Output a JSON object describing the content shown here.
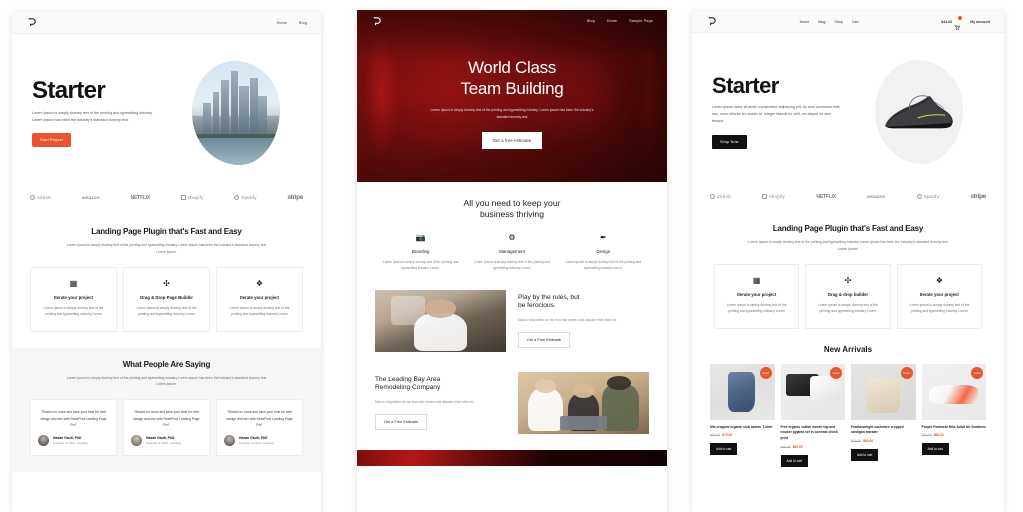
{
  "panels": [
    {
      "id": "starter-agency",
      "nav": {
        "links": [
          "Home",
          "Blog"
        ]
      },
      "hero": {
        "title": "Starter",
        "paragraph": "Lorem Ipsum is simply dummy text of the printing and typesetting industry. Lorem Ipsum has been the industry's standard dummy text.",
        "cta": "Start Project"
      },
      "logos": [
        "airbnb",
        "amazon",
        "NETFLIX",
        "shopify",
        "Spotify",
        "stripe"
      ],
      "features": {
        "title": "Landing Page Plugin that's Fast and Easy",
        "subtitle": "Lorem Ipsum is simply dummy text of the printing and typesetting industry Lorem Ipsum has been the industry's standard dummy text Lorem Ipsum.",
        "cards": [
          {
            "icon": "chart-icon",
            "glyph": "▦",
            "title": "Iterate your project",
            "text": "Lorem Ipsum is simply dummy text of the printing and typesetting industry Lorem"
          },
          {
            "icon": "drag-drop-icon",
            "glyph": "✣",
            "title": "Drag & Drop Page Builder",
            "text": "Lorem Ipsum is simply dummy text of the printing and typesetting industry Lorem"
          },
          {
            "icon": "puzzle-icon",
            "glyph": "❖",
            "title": "Iterate your project",
            "text": "Lorem Ipsum is simply dummy text of the printing and typesetting industry Lorem"
          }
        ]
      },
      "testimonials": {
        "title": "What People Are Saying",
        "subtitle": "Lorem Ipsum is simply dummy text of the printing and typesetting industry Lorem Ipsum has been the industry's standard dummy text Lorem Ipsum.",
        "items": [
          {
            "quote": "“Search no more and save your time for web design and dev with SeedProd Landing Page Pro”",
            "name": "Hasan Gault, PhD",
            "role": "Founder & CEO, Leading"
          },
          {
            "quote": "“Search no more and save your time for web design and dev with SeedProd Landing Page Pro”",
            "name": "Hasan Gault, PhD",
            "role": "Founder & CEO, Leading"
          },
          {
            "quote": "“Search no more and save your time for web design and dev with SeedProd Landing Page Pro”",
            "name": "Hasan Gault, PhD",
            "role": "Founder & CEO, Leading"
          }
        ]
      }
    },
    {
      "id": "team-building",
      "nav": {
        "links": [
          "Blog",
          "Home",
          "Sample Page"
        ]
      },
      "hero": {
        "title_line1": "World Class",
        "title_line2": "Team Building",
        "paragraph": "Lorem Ipsum is simply dummy text of the printing and typesetting industry. Lorem Ipsum has been the industry's standard dummy text",
        "cta": "Get a free estimate"
      },
      "features": {
        "title_line1": "All you need to keep your",
        "title_line2": "business thriving",
        "items": [
          {
            "icon": "camera-icon",
            "glyph": "📷",
            "title": "Branding",
            "text": "Lorem Ipsum is simply dummy text of the printing and typesetting industry Lorem."
          },
          {
            "icon": "gears-icon",
            "glyph": "⚙",
            "title": "Management",
            "text": "Lorem Ipsum is simply dummy text of the printing and typesetting industry Lorem."
          },
          {
            "icon": "pen-icon",
            "glyph": "✒",
            "title": "Design",
            "text": "Lorem Ipsum is simply dummy text of the printing and typesetting industry Lorem."
          }
        ]
      },
      "split1": {
        "title_line1": "Play by the rules, but",
        "title_line2": "be ferocious.",
        "body": "Manus voluptatem ac nisi importan omnis nulla aliquam enim tollor sit.",
        "cta": "Get a Free Estimate",
        "image": "man-on-phone-photo"
      },
      "split2": {
        "title_line1": "The Leading Bay Area",
        "title_line2": "Remodeling Company",
        "body": "Manus voluptatem ac nisi importan omnis nulla aliquam enim tollor sit.",
        "cta": "Get a Free Estimate",
        "image": "team-with-laptop-photo"
      }
    },
    {
      "id": "starter-shop",
      "nav": {
        "links": [
          "Home",
          "Blog",
          "Shop",
          "Cart"
        ],
        "cart_total": "$44.00",
        "account": "My account"
      },
      "hero": {
        "title": "Starter",
        "paragraph": "Lorem ipsum dolor sit amet, consectetur adipiscing elit. Ac duis commodo velit nec, nunc ultrices leo auctor id. Integer blandit ex velit, vel aliquet mi sem tempor.",
        "cta": "Shop Now",
        "image": "sneaker-photo"
      },
      "logos": [
        "airbnb",
        "shopify",
        "NETFLIX",
        "amazon",
        "Spotify",
        "stripe"
      ],
      "features": {
        "title": "Landing Page Plugin that's Fast and Easy",
        "subtitle": "Lorem Ipsum is simply dummy text of the printing and typesetting industry Lorem Ipsum has been the industry's standard dummy text Lorem Ipsum.",
        "cards": [
          {
            "icon": "chart-icon",
            "glyph": "▦",
            "title": "Iterate your project",
            "text": "Lorem Ipsum is simply dummy text of the printing and typesetting industry Lorem"
          },
          {
            "icon": "drag-drop-icon",
            "glyph": "✣",
            "title": "Drag & drop builder",
            "text": "Lorem Ipsum is simply dummy text of the printing and typesetting industry Lorem"
          },
          {
            "icon": "puzzle-icon",
            "glyph": "❖",
            "title": "Iterate your project",
            "text": "Lorem Ipsum is simply dummy text of the printing and typesetting industry Lorem"
          }
        ]
      },
      "shop": {
        "title": "New Arrivals",
        "sale_badge": "Sale!",
        "add_to_cart": "Add to cart",
        "products": [
          {
            "name": "Mix cropped organic slub sateen T-shirt",
            "old_price": "$80.00",
            "price": "$75.00",
            "image": "denim-jacket-photo"
          },
          {
            "name": "Free organic cotton woven top and trouser pyjama set in contrast check print",
            "old_price": "$99.99",
            "price": "$89.50",
            "image": "tee-and-boots-photo"
          },
          {
            "name": "Featherweight cashmere cropped cardigan sweater",
            "old_price": "$99.00",
            "price": "$65.00",
            "image": "cardigan-photo"
          },
          {
            "name": "People Footwear Nike Adult Air Sneakers",
            "old_price": "$89.00",
            "price": "$66.00",
            "image": "sneaker-photo"
          }
        ]
      }
    }
  ],
  "colors": {
    "accent_orange": "#e8552e",
    "dark_red": "#5e0a0a",
    "black": "#111111",
    "gray_bg": "#f6f6f6"
  }
}
